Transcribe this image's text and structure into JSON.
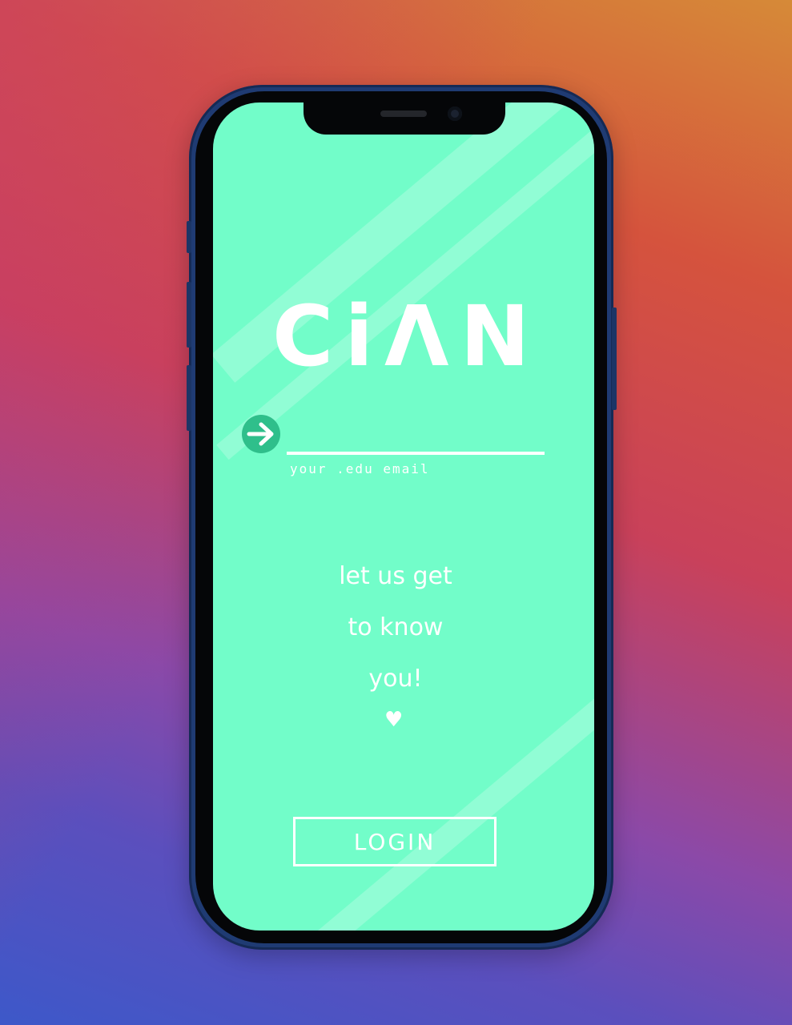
{
  "app": {
    "brand_name": "CiΛN",
    "accent_color": "#72fdc9"
  },
  "login_form": {
    "submit_icon": "arrow-right-icon",
    "email_value": "",
    "email_placeholder": "",
    "email_hint": "your .edu email"
  },
  "tagline": {
    "line1": "let us get",
    "line2": "to know",
    "line3": "you!",
    "heart_icon": "heart-icon",
    "heart_glyph": "♥"
  },
  "actions": {
    "login_label": "LOGIN"
  }
}
